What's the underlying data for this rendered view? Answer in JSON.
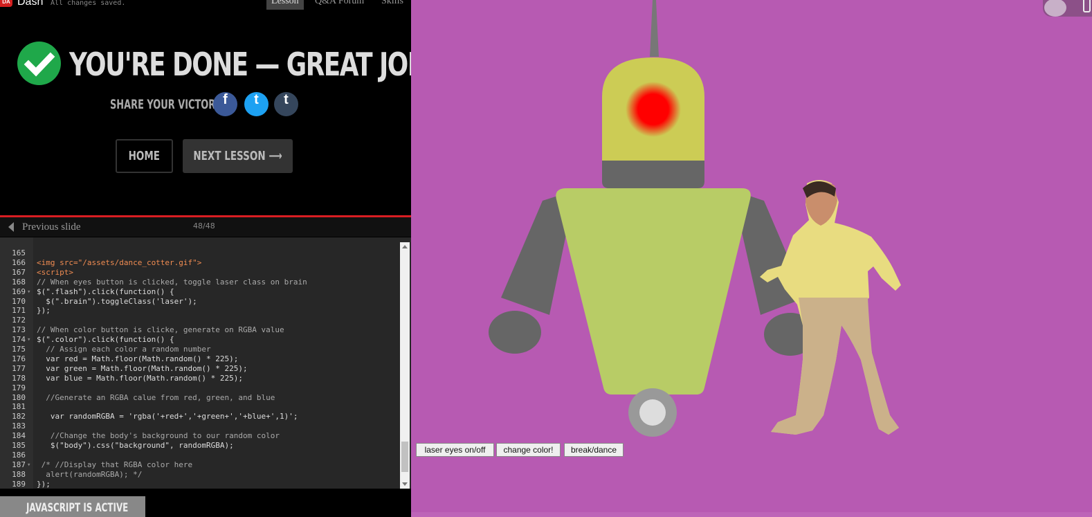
{
  "header": {
    "logo_text": "DA",
    "brand": "Dash",
    "save_status": "All changes saved.",
    "tabs": [
      {
        "label": "Lesson",
        "active": true
      },
      {
        "label": "Q&A Forum",
        "active": false
      },
      {
        "label": "Skills",
        "active": false
      }
    ]
  },
  "completion": {
    "title": "YOU'RE DONE — GREAT JOB!",
    "share_label": "SHARE YOUR VICTORY:",
    "social": [
      {
        "name": "facebook",
        "glyph": "f",
        "color": "#3b5998"
      },
      {
        "name": "twitter",
        "glyph": "t",
        "color": "#1da1f2"
      },
      {
        "name": "tumblr",
        "glyph": "t",
        "color": "#35465c"
      }
    ],
    "home_label": "HOME",
    "next_label": "NEXT LESSON ⟶"
  },
  "slides": {
    "prev_label": "Previous slide",
    "counter": "48/48"
  },
  "editor": {
    "lines": [
      {
        "n": "165",
        "text": ""
      },
      {
        "n": "166",
        "text": "<img src=\"/assets/dance_cotter.gif\">"
      },
      {
        "n": "167",
        "text": "<script>"
      },
      {
        "n": "168",
        "text": "// When eyes button is clicked, toggle laser class on brain"
      },
      {
        "n": "169",
        "text": "$(\".flash\").click(function() {"
      },
      {
        "n": "170",
        "text": "  $(\".brain\").toggleClass('laser');"
      },
      {
        "n": "171",
        "text": "});"
      },
      {
        "n": "172",
        "text": ""
      },
      {
        "n": "173",
        "text": "// When color button is clicke, generate on RGBA value"
      },
      {
        "n": "174",
        "text": "$(\".color\").click(function() {"
      },
      {
        "n": "175",
        "text": "  // Assign each color a random number"
      },
      {
        "n": "176",
        "text": "  var red = Math.floor(Math.random() * 225);"
      },
      {
        "n": "177",
        "text": "  var green = Math.floor(Math.random() * 225);"
      },
      {
        "n": "178",
        "text": "  var blue = Math.floor(Math.random() * 225);"
      },
      {
        "n": "179",
        "text": ""
      },
      {
        "n": "180",
        "text": "  //Generate an RGBA calue from red, green, and blue"
      },
      {
        "n": "181",
        "text": ""
      },
      {
        "n": "182",
        "text": "   var randomRGBA = 'rgba('+red+','+green+','+blue+',1)';"
      },
      {
        "n": "183",
        "text": ""
      },
      {
        "n": "184",
        "text": "   //Change the body's background to our random color"
      },
      {
        "n": "185",
        "text": "   $(\"body\").css(\"background\", randomRGBA);"
      },
      {
        "n": "186",
        "text": ""
      },
      {
        "n": "187",
        "text": " /* //Display that RGBA color here"
      },
      {
        "n": "188",
        "text": "  alert(randomRGBA); */"
      },
      {
        "n": "189",
        "text": "});"
      }
    ]
  },
  "footer": {
    "js_status": "JAVASCRIPT IS ACTIVE"
  },
  "preview": {
    "background": "#b75ab2",
    "buttons": {
      "laser": "laser eyes on/off",
      "color": "change color!",
      "dance": "break/dance"
    }
  }
}
